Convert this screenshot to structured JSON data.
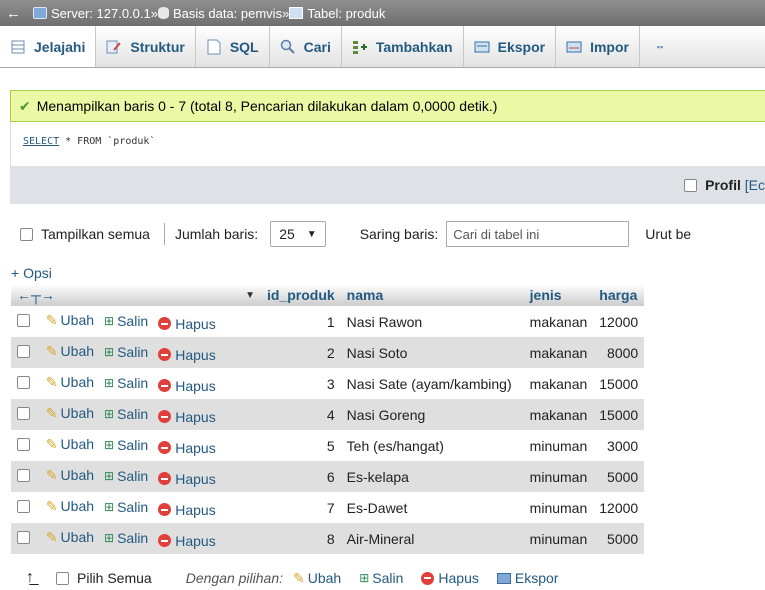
{
  "breadcrumb": {
    "server": "Server: 127.0.0.1",
    "database": "Basis data: pemvis",
    "table": "Tabel: produk",
    "separator": "»"
  },
  "tabs": [
    {
      "label": "Jelajahi",
      "icon": "browse-icon"
    },
    {
      "label": "Struktur",
      "icon": "structure-icon"
    },
    {
      "label": "SQL",
      "icon": "sql-icon"
    },
    {
      "label": "Cari",
      "icon": "search-icon"
    },
    {
      "label": "Tambahkan",
      "icon": "insert-icon"
    },
    {
      "label": "Ekspor",
      "icon": "export-icon"
    },
    {
      "label": "Impor",
      "icon": "import-icon"
    }
  ],
  "message": "Menampilkan baris 0 - 7 (total 8, Pencarian dilakukan dalam 0,0000 detik.)",
  "sql": {
    "select": "SELECT",
    "rest": " * FROM `produk`"
  },
  "profil": {
    "label": "Profil",
    "edit": "[Ec"
  },
  "nav": {
    "show_all": "Tampilkan semua",
    "rows_label": "Jumlah baris:",
    "rows_value": "25",
    "filter_label": "Saring baris:",
    "filter_placeholder": "Cari di tabel ini",
    "sort_label": "Urut be"
  },
  "opsi": "+ Opsi",
  "table": {
    "columns": [
      "id_produk",
      "nama",
      "jenis",
      "harga"
    ],
    "actions": {
      "edit": "Ubah",
      "copy": "Salin",
      "delete": "Hapus"
    },
    "rows": [
      {
        "id": "1",
        "nama": "Nasi Rawon",
        "jenis": "makanan",
        "harga": "12000"
      },
      {
        "id": "2",
        "nama": "Nasi Soto",
        "jenis": "makanan",
        "harga": "8000"
      },
      {
        "id": "3",
        "nama": "Nasi Sate (ayam/kambing)",
        "jenis": "makanan",
        "harga": "15000"
      },
      {
        "id": "4",
        "nama": "Nasi Goreng",
        "jenis": "makanan",
        "harga": "15000"
      },
      {
        "id": "5",
        "nama": "Teh (es/hangat)",
        "jenis": "minuman",
        "harga": "3000"
      },
      {
        "id": "6",
        "nama": "Es-kelapa",
        "jenis": "minuman",
        "harga": "5000"
      },
      {
        "id": "7",
        "nama": "Es-Dawet",
        "jenis": "minuman",
        "harga": "12000"
      },
      {
        "id": "8",
        "nama": "Air-Mineral",
        "jenis": "minuman",
        "harga": "5000"
      }
    ]
  },
  "bottom": {
    "select_all": "Pilih Semua",
    "with_selected": "Dengan pilihan:",
    "edit": "Ubah",
    "copy": "Salin",
    "delete": "Hapus",
    "export": "Ekspor"
  }
}
